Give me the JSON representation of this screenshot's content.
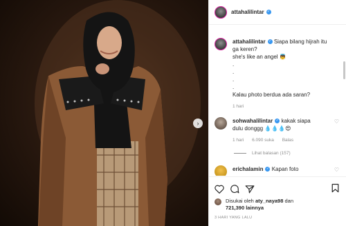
{
  "post": {
    "author": "attahalilintar",
    "caption_lines": [
      "Siapa bilang hijrah itu",
      "ga keren?",
      "she's like an angel 👼",
      ".",
      ".",
      ".",
      ".",
      "Kalau photo berdua ada saran?"
    ],
    "caption_time": "1 hari",
    "time_ago": "3 HARI YANG LALU"
  },
  "comments": [
    {
      "user": "sohwahalilintar",
      "text_line1": "kakak siapa",
      "text_line2": "dulu donggg 💧💧💧😍",
      "time": "1 hari",
      "likes": "6.090 suka",
      "reply": "Balas",
      "view_replies": "Lihat balasan (157)"
    },
    {
      "user": "erichalamin",
      "text_line1": "Kapan foto"
    }
  ],
  "likes": {
    "line1": "Disukai oleh",
    "user": "aty_naya98",
    "and": "dan",
    "count": "721,390",
    "others": "lainnya"
  },
  "nav": {
    "next_glyph": "›"
  },
  "icons": {
    "heart": "heart-icon",
    "comment": "comment-icon",
    "share": "share-icon",
    "save": "bookmark-icon"
  }
}
